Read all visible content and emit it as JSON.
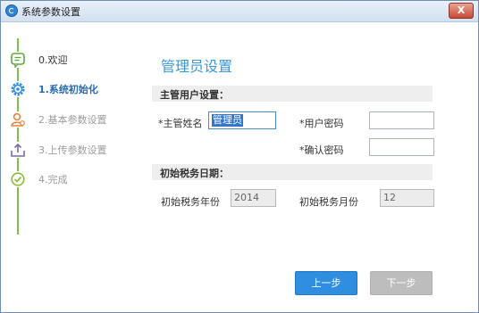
{
  "window": {
    "title": "系统参数设置",
    "close_label": "X"
  },
  "steps": [
    {
      "label": "0.欢迎",
      "state": "done",
      "icon": "message-icon"
    },
    {
      "label": "1.系统初始化",
      "state": "active",
      "icon": "gear-icon"
    },
    {
      "label": "2.基本参数设置",
      "state": "future",
      "icon": "user-icon"
    },
    {
      "label": "3.上传参数设置",
      "state": "future",
      "icon": "upload-icon"
    },
    {
      "label": "4.完成",
      "state": "future",
      "icon": "check-icon"
    }
  ],
  "main": {
    "title": "管理员设置",
    "admin_section": {
      "title": "主管用户设置：",
      "name_label": "*主管姓名",
      "name_value": "管理员",
      "password_label": "*用户密码",
      "password_value": "",
      "confirm_label": "*确认密码",
      "confirm_value": ""
    },
    "tax_section": {
      "title": "初始税务日期：",
      "year_label": "初始税务年份",
      "year_value": "2014",
      "month_label": "初始税务月份",
      "month_value": "12"
    },
    "buttons": {
      "prev": "上一步",
      "next": "下一步"
    }
  },
  "colors": {
    "accent": "#3b97d8",
    "step_line": "#7cc04a",
    "button_primary": "#2f8ee0"
  }
}
